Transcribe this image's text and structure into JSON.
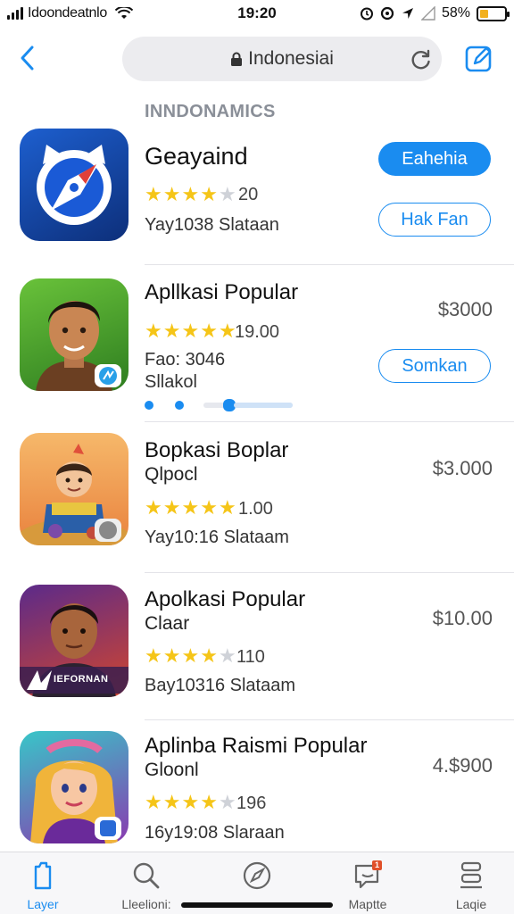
{
  "status_bar": {
    "carrier": "Idoondeatnlo",
    "time": "19:20",
    "battery_percent_text": "58%",
    "battery_level": 0.35
  },
  "nav": {
    "url": "Indonesiai"
  },
  "section_title": "INNDONAMICS",
  "apps": [
    {
      "name": "Geayaind",
      "rating_value": "20",
      "stars_filled": 4,
      "meta": "Yay1038 Slataan",
      "primary_button": "Eahehia",
      "secondary_button": "Hak Fan",
      "icon": "browser-compass-icon"
    },
    {
      "name": "Apllkasi Popular",
      "rating_value": "19.00",
      "stars_filled": 5,
      "meta_line1": "Fao: 3046",
      "meta_line2": "Sllakol",
      "price": "$3000",
      "secondary_button": "Somkan",
      "icon": "man-portrait-icon"
    },
    {
      "name": "Bopkasi Boplar",
      "sub": "Qlpocl",
      "rating_value": "1.00",
      "stars_filled": 5,
      "meta": "Yay10:16 Slataam",
      "price": "$3.000",
      "icon": "cartoon-kid-icon"
    },
    {
      "name": "Apolkasi Popular",
      "sub": "Claar",
      "rating_value": "110",
      "stars_filled": 4,
      "meta": "Bay10316 Slataam",
      "price": "$10.00",
      "icon": "man-poster-icon",
      "icon_caption": "IEFORNAN"
    },
    {
      "name": "Aplinba Raismi Popular",
      "sub": "Gloonl",
      "rating_value": "196",
      "stars_filled": 4,
      "meta": "16y19:08 Slaraan",
      "price": "4.$900",
      "icon": "cartoon-girl-icon"
    }
  ],
  "tabs": [
    {
      "label": "Layer",
      "icon": "phone-icon"
    },
    {
      "label": "Lleelioni:",
      "icon": "search-icon"
    },
    {
      "label": "",
      "icon": "compass-icon"
    },
    {
      "label": "Maptte",
      "icon": "chat-icon",
      "badge": "1"
    },
    {
      "label": "Laqie",
      "icon": "stack-icon"
    }
  ],
  "colors": {
    "accent": "#1a8cf0",
    "star": "#f5c518",
    "battery": "#f2b01e"
  }
}
